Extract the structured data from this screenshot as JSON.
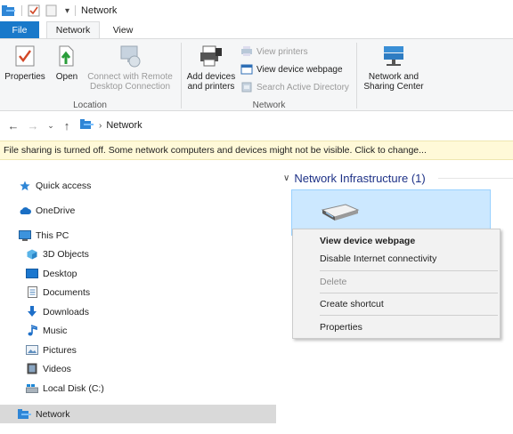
{
  "window": {
    "title": "Network",
    "quick_access": {
      "qa_down_label": "▾"
    }
  },
  "tabs": [
    {
      "label": "File"
    },
    {
      "label": "Network"
    },
    {
      "label": "View"
    }
  ],
  "ribbon": {
    "location_group": {
      "label": "Location",
      "properties": "Properties",
      "open": "Open",
      "connect_remote_line1": "Connect with Remote",
      "connect_remote_line2": "Desktop Connection"
    },
    "network_group": {
      "label": "Network",
      "add_devices_line1": "Add devices",
      "add_devices_line2": "and printers",
      "view_printers": "View printers",
      "view_device_webpage": "View device webpage",
      "search_active_directory": "Search Active Directory"
    },
    "sharing_center": {
      "line1": "Network and",
      "line2": "Sharing Center"
    }
  },
  "address": {
    "path": "Network",
    "chevron": "›"
  },
  "infobar": {
    "text": "File sharing is turned off. Some network computers and devices might not be visible. Click to change..."
  },
  "navpane": {
    "items": [
      {
        "label": "Quick access",
        "icon": "star-icon"
      },
      {
        "label": "OneDrive",
        "icon": "cloud-icon"
      },
      {
        "label": "This PC",
        "icon": "computer-icon"
      },
      {
        "label": "3D Objects",
        "icon": "cube-icon"
      },
      {
        "label": "Desktop",
        "icon": "desktop-icon"
      },
      {
        "label": "Documents",
        "icon": "document-icon"
      },
      {
        "label": "Downloads",
        "icon": "download-icon"
      },
      {
        "label": "Music",
        "icon": "music-icon"
      },
      {
        "label": "Pictures",
        "icon": "pictures-icon"
      },
      {
        "label": "Videos",
        "icon": "videos-icon"
      },
      {
        "label": "Local Disk (C:)",
        "icon": "disk-icon"
      },
      {
        "label": "Network",
        "icon": "network-icon"
      }
    ]
  },
  "content": {
    "group_header": "Network Infrastructure (1)",
    "group_chevron": "∨"
  },
  "context_menu": {
    "items": [
      {
        "label": "View device webpage",
        "bold": true,
        "enabled": true
      },
      {
        "label": "Disable Internet connectivity",
        "bold": false,
        "enabled": true
      },
      {
        "label": "Delete",
        "bold": false,
        "enabled": false
      },
      {
        "label": "Create shortcut",
        "bold": false,
        "enabled": true
      },
      {
        "label": "Properties",
        "bold": false,
        "enabled": true
      }
    ]
  },
  "colors": {
    "accent": "#1979ca",
    "selection": "#cce8ff",
    "infobar": "#fff9d8",
    "header_text": "#1e3287"
  }
}
